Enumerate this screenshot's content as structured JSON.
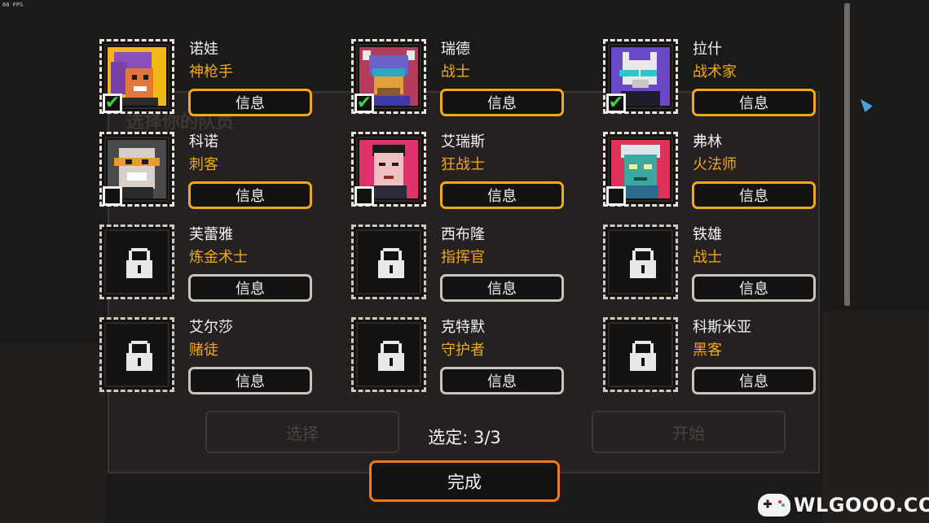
{
  "overlay": {
    "fps": "60 FPS"
  },
  "background": {
    "ghost_title": "选择你的队员",
    "ghost_button_left": "选择",
    "ghost_button_right": "开始"
  },
  "roster": [
    {
      "name": "诺娃",
      "class": "神枪手",
      "info_label": "信息",
      "locked": false,
      "selected": true,
      "icon": "nova-portrait"
    },
    {
      "name": "瑞德",
      "class": "战士",
      "info_label": "信息",
      "locked": false,
      "selected": true,
      "icon": "reid-portrait"
    },
    {
      "name": "拉什",
      "class": "战术家",
      "info_label": "信息",
      "locked": false,
      "selected": true,
      "icon": "rush-portrait"
    },
    {
      "name": "科诺",
      "class": "刺客",
      "info_label": "信息",
      "locked": false,
      "selected": false,
      "icon": "kono-portrait"
    },
    {
      "name": "艾瑞斯",
      "class": "狂战士",
      "info_label": "信息",
      "locked": false,
      "selected": false,
      "icon": "ares-portrait"
    },
    {
      "name": "弗林",
      "class": "火法师",
      "info_label": "信息",
      "locked": false,
      "selected": false,
      "icon": "flynn-portrait"
    },
    {
      "name": "芙蕾雅",
      "class": "炼金术士",
      "info_label": "信息",
      "locked": true,
      "selected": false,
      "icon": "lock-icon"
    },
    {
      "name": "西布隆",
      "class": "指挥官",
      "info_label": "信息",
      "locked": true,
      "selected": false,
      "icon": "lock-icon"
    },
    {
      "name": "铁雄",
      "class": "战士",
      "info_label": "信息",
      "locked": true,
      "selected": false,
      "icon": "lock-icon"
    },
    {
      "name": "艾尔莎",
      "class": "赌徒",
      "info_label": "信息",
      "locked": true,
      "selected": false,
      "icon": "lock-icon"
    },
    {
      "name": "克特默",
      "class": "守护者",
      "info_label": "信息",
      "locked": true,
      "selected": false,
      "icon": "lock-icon"
    },
    {
      "name": "科斯米亚",
      "class": "黑客",
      "info_label": "信息",
      "locked": true,
      "selected": false,
      "icon": "lock-icon"
    }
  ],
  "footer": {
    "selected_count": "选定: 3/3",
    "done_label": "完成"
  },
  "watermark": {
    "text": "WLGOOO.COM"
  },
  "colors": {
    "accent": "#f0a81c",
    "done_border": "#f07a1c",
    "check": "#3fcf3f",
    "background": "#1c1a19"
  }
}
